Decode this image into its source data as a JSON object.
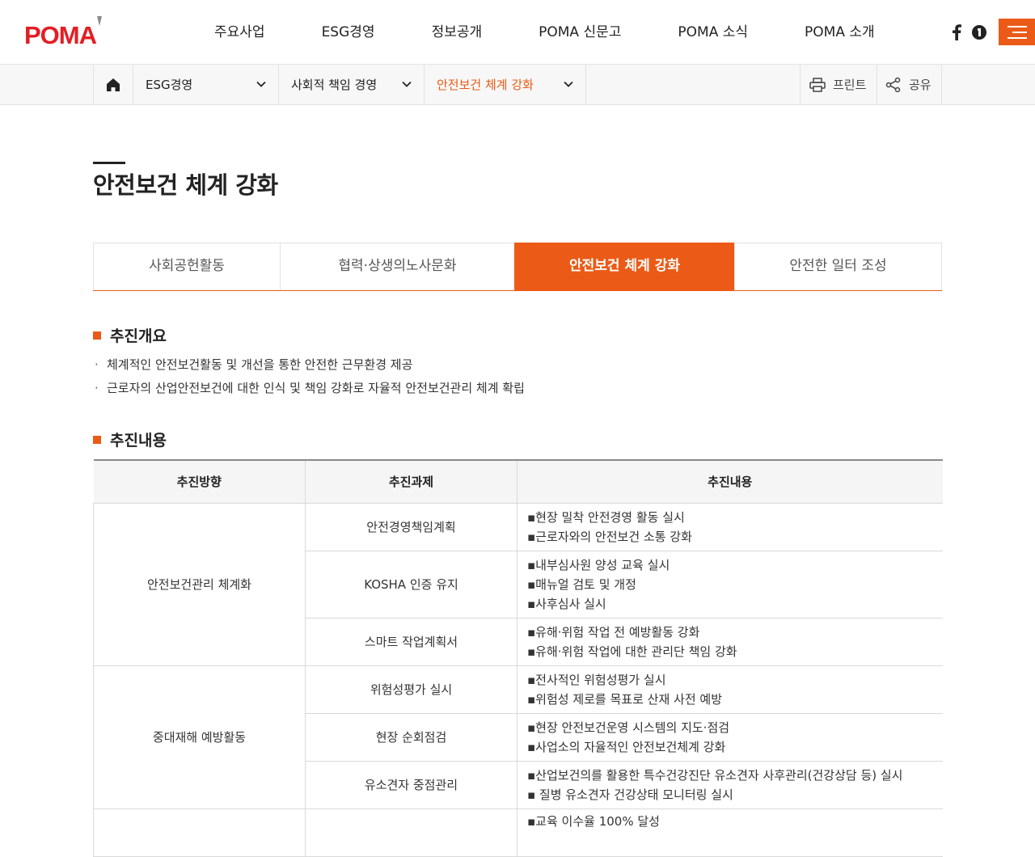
{
  "header": {
    "logo_text": "POMA",
    "nav": [
      "주요사업",
      "ESG경영",
      "정보공개",
      "POMA 신문고",
      "POMA 소식",
      "POMA 소개"
    ],
    "brand_color": "#eb5b17",
    "sns": [
      "facebook-icon",
      "blog-icon"
    ]
  },
  "location": {
    "depth1": "ESG경영",
    "depth2": "사회적 책임 경영",
    "depth3": "안전보건 체계 강화",
    "print_label": "프린트",
    "share_label": "공유"
  },
  "page_title": "안전보건 체계 강화",
  "tabs": [
    {
      "label": "사회공헌활동",
      "active": false
    },
    {
      "label": "협력·상생의노사문화",
      "active": false
    },
    {
      "label": "안전보건 체계 강화",
      "active": true
    },
    {
      "label": "안전한 일터 조성",
      "active": false
    }
  ],
  "overview": {
    "title": "추진개요",
    "items": [
      "체계적인 안전보건활동 및 개선을 통한 안전한 근무환경 제공",
      "근로자의 산업안전보건에 대한 인식 및 책임 강화로 자율적 안전보건관리 체계 확립"
    ]
  },
  "content": {
    "title": "추진내용",
    "headers": [
      "추진방향",
      "추진과제",
      "추진내용"
    ],
    "groups": [
      {
        "direction": "안전보건관리 체계화",
        "rows": [
          {
            "task": "안전경영책임계획",
            "details": [
              "▪현장 밀착 안전경영 활동 실시",
              "▪근로자와의 안전보건 소통 강화"
            ]
          },
          {
            "task": "KOSHA 인증 유지",
            "details": [
              "▪내부심사원 양성 교육 실시",
              "▪매뉴얼 검토 및 개정",
              "▪사후심사 실시"
            ]
          },
          {
            "task": "스마트 작업계획서",
            "details": [
              "▪유해·위험 작업 전 예방활동 강화",
              "▪유해·위험 작업에 대한 관리단 책임 강화"
            ]
          }
        ]
      },
      {
        "direction": "중대재해 예방활동",
        "rows": [
          {
            "task": "위험성평가 실시",
            "details": [
              "▪전사적인 위험성평가 실시",
              "▪위험성 제로를 목표로 산재 사전 예방"
            ]
          },
          {
            "task": "현장 순회점검",
            "details": [
              "▪현장 안전보건운영 시스템의 지도·점검",
              "▪사업소의 자율적인 안전보건체계 강화"
            ]
          },
          {
            "task": "유소견자 중점관리",
            "details": [
              "▪산업보건의를 활용한 특수건강진단 유소견자 사후관리(건강상담 등) 실시",
              "▪ 질병 유소견자 건강상태 모니터링 실시"
            ]
          }
        ]
      },
      {
        "direction": "",
        "rows": [
          {
            "task": "",
            "details": [
              "▪교육 이수율 100% 달성"
            ]
          }
        ]
      }
    ]
  }
}
